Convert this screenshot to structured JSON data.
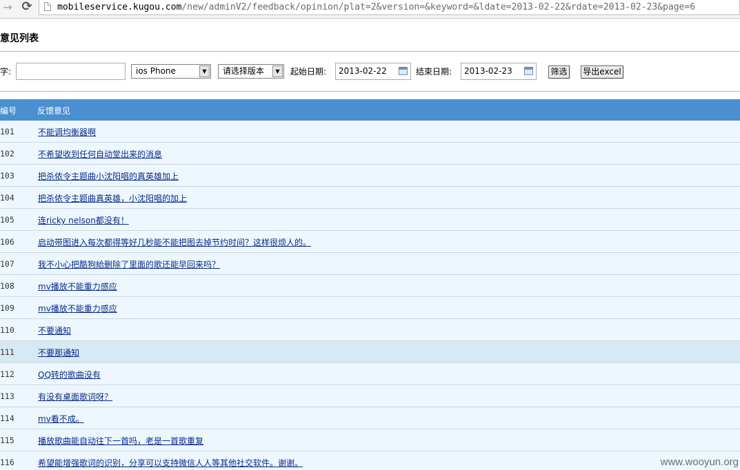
{
  "browser": {
    "forward_icon": "forward-arrow-icon",
    "reload_icon": "reload-icon",
    "url_host": "mobileservice.kugou.com",
    "url_path": "/new/adminV2/feedback/opinion/plat=2&version=&keyword=&ldate=2013-02-22&rdate=2013-02-23&page=6"
  },
  "page": {
    "title": "意见列表"
  },
  "filters": {
    "keyword_label": "字:",
    "keyword_value": "",
    "platform_selected": "ios Phone",
    "version_selected": "请选择版本",
    "start_label": "起始日期:",
    "start_date": "2013-02-22",
    "end_label": "结束日期:",
    "end_date": "2013-02-23",
    "filter_button": "筛选",
    "export_button": "导出excel"
  },
  "table": {
    "headers": [
      "编号",
      "反馈意见"
    ],
    "rows": [
      {
        "id": "101",
        "text": "不能调均衡器啊"
      },
      {
        "id": "102",
        "text": "不希望收到任何自动堂出来的消息"
      },
      {
        "id": "103",
        "text": "把杀侬令主题曲小沈阳唱的真英雄加上"
      },
      {
        "id": "104",
        "text": "把杀侬令主题曲真英雄，小沈阳唱的加上"
      },
      {
        "id": "105",
        "text": "连ricky nelson都没有！"
      },
      {
        "id": "106",
        "text": "启动带图进入每次都得等好几秒能不能把图去掉节约时间？这样很烦人的。"
      },
      {
        "id": "107",
        "text": "我不小心把酷狗給删除了里面的歌还能早回来吗？"
      },
      {
        "id": "108",
        "text": "mv播放不能重力感应"
      },
      {
        "id": "109",
        "text": "mv播放不能重力感应"
      },
      {
        "id": "110",
        "text": "不要通知"
      },
      {
        "id": "111",
        "text": "不要那通知"
      },
      {
        "id": "112",
        "text": "QQ转的歌曲没有"
      },
      {
        "id": "113",
        "text": "有没有桌面歌词呀？"
      },
      {
        "id": "114",
        "text": "mv看不成。"
      },
      {
        "id": "115",
        "text": "播放歌曲能自动往下一首吗，老是一首歌重复"
      },
      {
        "id": "116",
        "text": "希望能增强歌词的识别，分享可以支持微信人人等其他社交软件。谢谢。"
      }
    ]
  },
  "watermark": "www.wooyun.org"
}
